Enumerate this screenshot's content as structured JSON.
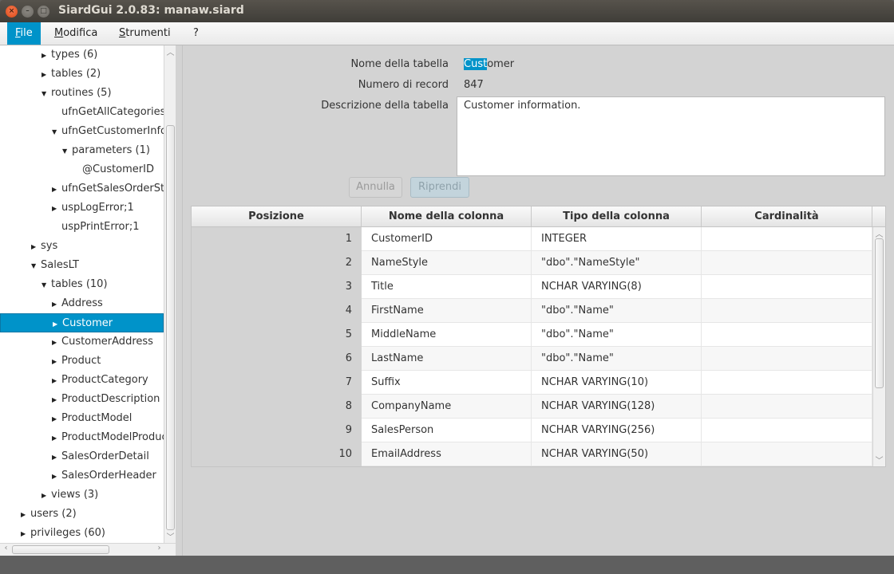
{
  "window": {
    "title": "SiardGui 2.0.83: manaw.siard",
    "close_glyph": "×",
    "minimize_glyph": "–",
    "maximize_glyph": "□"
  },
  "menubar": {
    "items": [
      {
        "label": "File",
        "mnemonic": "F",
        "rest": "ile",
        "active": true
      },
      {
        "label": "Modifica",
        "mnemonic": "M",
        "rest": "odifica",
        "active": false
      },
      {
        "label": "Strumenti",
        "mnemonic": "S",
        "rest": "trumenti",
        "active": false
      },
      {
        "label": "?",
        "mnemonic": "",
        "rest": "?",
        "active": false
      }
    ]
  },
  "tree": {
    "rows": [
      {
        "label": "types (6)",
        "level": 3,
        "arrow": "right"
      },
      {
        "label": "tables (2)",
        "level": 3,
        "arrow": "right"
      },
      {
        "label": "routines (5)",
        "level": 3,
        "arrow": "down"
      },
      {
        "label": "ufnGetAllCategories",
        "level": 4,
        "arrow": "none"
      },
      {
        "label": "ufnGetCustomerInformation",
        "level": 4,
        "arrow": "down"
      },
      {
        "label": "parameters (1)",
        "level": 5,
        "arrow": "down"
      },
      {
        "label": "@CustomerID",
        "level": 6,
        "arrow": "none"
      },
      {
        "label": "ufnGetSalesOrderStatusText",
        "level": 4,
        "arrow": "right"
      },
      {
        "label": "uspLogError;1",
        "level": 4,
        "arrow": "right"
      },
      {
        "label": "uspPrintError;1",
        "level": 4,
        "arrow": "none"
      },
      {
        "label": "sys",
        "level": 2,
        "arrow": "right"
      },
      {
        "label": "SalesLT",
        "level": 2,
        "arrow": "down"
      },
      {
        "label": "tables (10)",
        "level": 3,
        "arrow": "down"
      },
      {
        "label": "Address",
        "level": 4,
        "arrow": "right"
      },
      {
        "label": "Customer",
        "level": 4,
        "arrow": "right",
        "selected": true
      },
      {
        "label": "CustomerAddress",
        "level": 4,
        "arrow": "right"
      },
      {
        "label": "Product",
        "level": 4,
        "arrow": "right"
      },
      {
        "label": "ProductCategory",
        "level": 4,
        "arrow": "right"
      },
      {
        "label": "ProductDescription",
        "level": 4,
        "arrow": "right"
      },
      {
        "label": "ProductModel",
        "level": 4,
        "arrow": "right"
      },
      {
        "label": "ProductModelProductDescription",
        "level": 4,
        "arrow": "right"
      },
      {
        "label": "SalesOrderDetail",
        "level": 4,
        "arrow": "right"
      },
      {
        "label": "SalesOrderHeader",
        "level": 4,
        "arrow": "right"
      },
      {
        "label": "views (3)",
        "level": 3,
        "arrow": "right"
      },
      {
        "label": "users (2)",
        "level": 1,
        "arrow": "right"
      },
      {
        "label": "privileges (60)",
        "level": 1,
        "arrow": "right"
      }
    ]
  },
  "details": {
    "table_name_label": "Nome della tabella",
    "table_name_selected": "Cust",
    "table_name_rest": "omer",
    "record_count_label": "Numero di record",
    "record_count": "847",
    "description_label": "Descrizione della tabella",
    "description": "Customer information.",
    "cancel_label": "Annulla",
    "restore_label": "Riprendi"
  },
  "columns_table": {
    "headers": [
      "Posizione",
      "Nome della colonna",
      "Tipo della colonna",
      "Cardinalità"
    ],
    "rows": [
      {
        "pos": "1",
        "name": "CustomerID",
        "type": "INTEGER",
        "card": ""
      },
      {
        "pos": "2",
        "name": "NameStyle",
        "type": "\"dbo\".\"NameStyle\"",
        "card": ""
      },
      {
        "pos": "3",
        "name": "Title",
        "type": "NCHAR VARYING(8)",
        "card": ""
      },
      {
        "pos": "4",
        "name": "FirstName",
        "type": "\"dbo\".\"Name\"",
        "card": ""
      },
      {
        "pos": "5",
        "name": "MiddleName",
        "type": "\"dbo\".\"Name\"",
        "card": ""
      },
      {
        "pos": "6",
        "name": "LastName",
        "type": "\"dbo\".\"Name\"",
        "card": ""
      },
      {
        "pos": "7",
        "name": "Suffix",
        "type": "NCHAR VARYING(10)",
        "card": ""
      },
      {
        "pos": "8",
        "name": "CompanyName",
        "type": "NCHAR VARYING(128)",
        "card": ""
      },
      {
        "pos": "9",
        "name": "SalesPerson",
        "type": "NCHAR VARYING(256)",
        "card": ""
      },
      {
        "pos": "10",
        "name": "EmailAddress",
        "type": "NCHAR VARYING(50)",
        "card": ""
      }
    ]
  },
  "colors": {
    "accent": "#0093c9",
    "titlebar": "#3f3d38",
    "panel_bg": "#d3d3d3"
  }
}
